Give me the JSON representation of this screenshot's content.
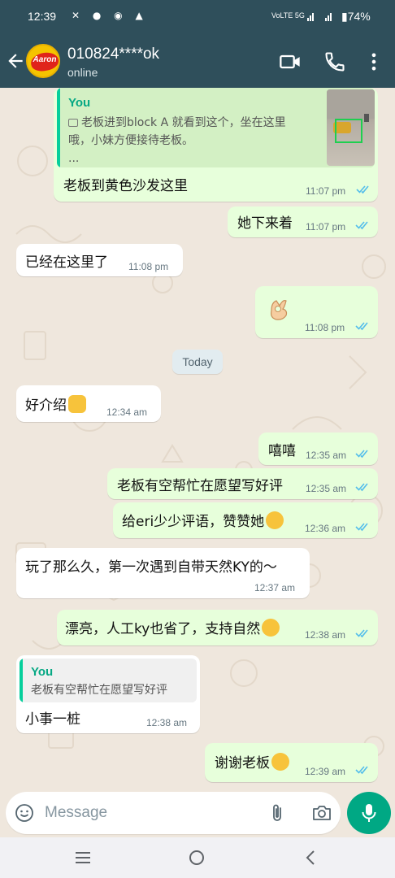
{
  "status_bar": {
    "time": "12:39",
    "network": "VoLTE 5G",
    "battery": "74%"
  },
  "header": {
    "contact_name": "010824****ok",
    "contact_status": "online",
    "avatar_text": "Aaron"
  },
  "messages": [
    {
      "from": "me",
      "quote_author": "You",
      "quote_line1": "老板进到block A 就看到这个，坐在这里",
      "quote_line2": "哦，小妹方便接待老板。",
      "quote_line3": "...",
      "text": "老板到黄色沙发这里",
      "time": "11:07 pm"
    },
    {
      "from": "me",
      "text": "她下来着",
      "time": "11:07 pm"
    },
    {
      "from": "them",
      "text": "已经在这里了",
      "time": "11:08 pm"
    },
    {
      "from": "me",
      "emoji": "ok-hand",
      "time": "11:08 pm"
    },
    {
      "from": "them",
      "text": "好介绍",
      "emoji": "thumbs-up",
      "time": "12:34 am"
    },
    {
      "from": "me",
      "text": "嘻嘻",
      "time": "12:35 am"
    },
    {
      "from": "me",
      "text": "老板有空帮忙在愿望写好评",
      "time": "12:35 am"
    },
    {
      "from": "me",
      "text": "给eri少少评语，赞赞她",
      "emoji": "smiling-face",
      "time": "12:36 am"
    },
    {
      "from": "them",
      "text": "玩了那么久，第一次遇到自带天然KY的～",
      "time": "12:37 am"
    },
    {
      "from": "me",
      "text": "漂亮，人工ky也省了，支持自然",
      "emoji": "kissing-face",
      "time": "12:38 am"
    },
    {
      "from": "them",
      "quote_author": "You",
      "quote_line1": "老板有空帮忙在愿望写好评",
      "text": "小事一桩",
      "time": "12:38 am"
    },
    {
      "from": "me",
      "text": "谢谢老板",
      "emoji": "party-face",
      "time": "12:39 am"
    }
  ],
  "day_separator": "Today",
  "composer": {
    "placeholder": "Message"
  },
  "colors": {
    "header": "#2f4f5b",
    "outgoing": "#e7ffdb",
    "incoming": "#ffffff",
    "accent": "#00a884",
    "read_ticks": "#53bdeb"
  }
}
